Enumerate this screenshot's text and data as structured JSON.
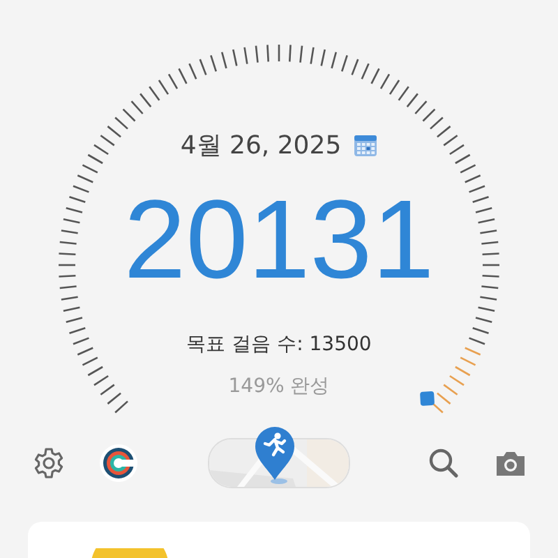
{
  "gauge": {
    "date": "4월 26, 2025",
    "steps": "20131",
    "goal": "목표 걸음 수: 13500",
    "percent": "149% 완성"
  }
}
